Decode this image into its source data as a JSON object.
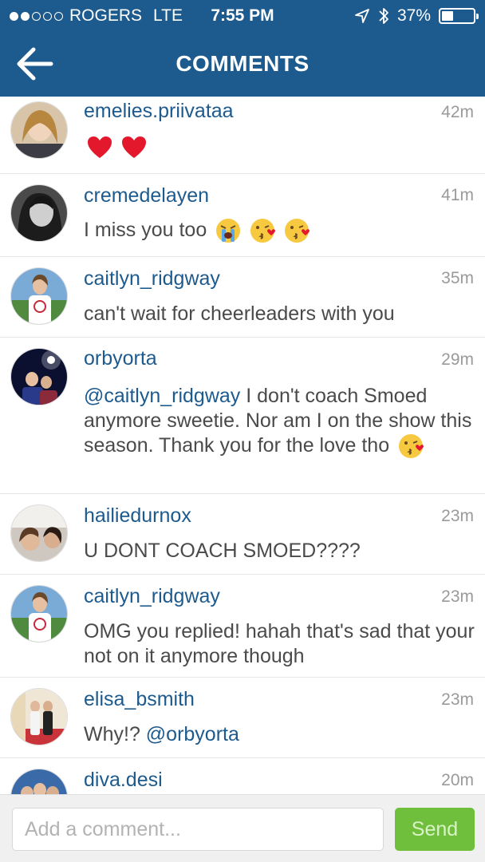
{
  "status_bar": {
    "carrier": "ROGERS",
    "network": "LTE",
    "time": "7:55 PM",
    "battery": "37%",
    "battery_level": 0.37,
    "signal_bars": 2
  },
  "header": {
    "title": "COMMENTS",
    "back_icon": "arrow-left-icon",
    "color": "#1d5a8e"
  },
  "comments": [
    {
      "username": "emelies.priivataa",
      "time": "42m",
      "text": ""
    },
    {
      "username": "cremedelayen",
      "time": "41m",
      "text": "I miss you too"
    },
    {
      "username": "caitlyn_ridgway",
      "time": "35m",
      "text": "can't wait for cheerleaders with you"
    },
    {
      "username": "orbyorta",
      "time": "29m",
      "mention": "@caitlyn_ridgway",
      "text": " I don't coach Smoed anymore sweetie. Nor am I on the show this season. Thank you for the love tho"
    },
    {
      "username": "hailiedurnox",
      "time": "23m",
      "text": "U DONT COACH SMOED????"
    },
    {
      "username": "caitlyn_ridgway",
      "time": "23m",
      "text": "OMG you replied! hahah that's sad that your not on it anymore though"
    },
    {
      "username": "elisa_bsmith",
      "time": "23m",
      "text": "Why!? ",
      "mention": "@orbyorta"
    },
    {
      "username": "diva.desi",
      "time": "20m",
      "text": ""
    }
  ],
  "footer": {
    "placeholder": "Add a comment...",
    "send_label": "Send",
    "send_color": "#6fbf3d"
  }
}
